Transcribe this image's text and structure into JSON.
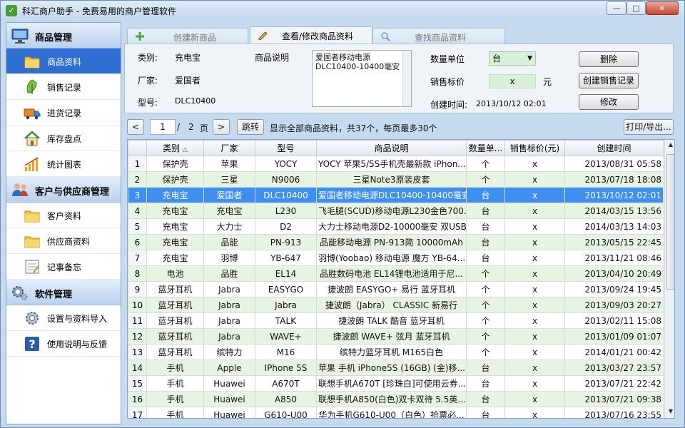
{
  "window": {
    "title": "科汇商户助手 - 免费易用的商户管理软件",
    "min": "—",
    "max": "□",
    "close": "✕"
  },
  "sidebar": {
    "groups": [
      {
        "label": "商品管理",
        "icon": "monitor-icon"
      },
      {
        "label": "客户与供应商管理",
        "icon": "people-icon"
      },
      {
        "label": "软件管理",
        "icon": "gears-icon"
      }
    ],
    "items": [
      {
        "label": "商品资料",
        "icon": "folder-icon",
        "active": true
      },
      {
        "label": "销售记录",
        "icon": "leaf-icon"
      },
      {
        "label": "进货记录",
        "icon": "truck-icon"
      },
      {
        "label": "库存盘点",
        "icon": "house-icon"
      },
      {
        "label": "统计图表",
        "icon": "chart-icon"
      },
      {
        "label": "客户资料",
        "icon": "folder-icon"
      },
      {
        "label": "供应商资料",
        "icon": "folder-icon"
      },
      {
        "label": "记事备忘",
        "icon": "notepad-icon"
      },
      {
        "label": "设置与资料导入",
        "icon": "gear-icon"
      },
      {
        "label": "使用说明与反馈",
        "icon": "help-icon"
      }
    ]
  },
  "tabs": [
    {
      "label": "创建新商品",
      "icon": "plus-icon"
    },
    {
      "label": "查看/修改商品资料",
      "icon": "pencil-icon",
      "active": true
    },
    {
      "label": "查找商品资料",
      "icon": "search-icon"
    }
  ],
  "form": {
    "category_label": "类别:",
    "category_value": "充电宝",
    "maker_label": "厂家:",
    "maker_value": "爱国者",
    "model_label": "型号:",
    "model_value": "DLC10400",
    "desc_label": "商品说明",
    "desc_line1": "爱国者移动电源",
    "desc_line2": "DLC10400-10400毫安",
    "unit_label": "数量单位",
    "unit_value": "台",
    "price_label": "销售标价",
    "price_value": "x",
    "price_unit": "元",
    "created_label": "创建时间:",
    "created_value": "2013/10/12 02:01",
    "delete_btn": "删除",
    "create_sale_btn": "创建销售记录",
    "modify_btn": "修改"
  },
  "pager": {
    "prev": "<",
    "page": "1",
    "sep": "/",
    "total": "2",
    "page_word": "页",
    "next": ">",
    "jump": "跳转",
    "info": "显示全部商品资料，共37个，每页最多30个",
    "print_export": "打印/导出..."
  },
  "table": {
    "headers": [
      "",
      "类别",
      "厂家",
      "型号",
      "商品说明",
      "数量单...",
      "销售标价(元)",
      "创建时间"
    ],
    "sort_indicator": "△",
    "rows": [
      [
        "1",
        "保护壳",
        "苹果",
        "YOCY",
        "YOCY 苹果5/5S手机壳最新款 iPhon...",
        "个",
        "x",
        "2013/08/31 05:58"
      ],
      [
        "2",
        "保护壳",
        "三星",
        "N9006",
        "三星Note3原装皮套",
        "个",
        "x",
        "2013/07/18 18:08"
      ],
      [
        "3",
        "充电宝",
        "爱国者",
        "DLC10400",
        "爱国者移动电源DLC10400-10400毫安",
        "台",
        "x",
        "2013/10/12 02:01"
      ],
      [
        "4",
        "充电宝",
        "充电宝",
        "L230",
        "飞毛腿(SCUD)移动电源L230金色700...",
        "台",
        "x",
        "2014/03/15 13:56"
      ],
      [
        "5",
        "充电宝",
        "大力士",
        "D2",
        "大力士移动电源D2-10000毫安 双USB",
        "台",
        "x",
        "2014/03/13 14:03"
      ],
      [
        "6",
        "充电宝",
        "品能",
        "PN-913",
        "品能移动电源 PN-913简 10000mAh",
        "台",
        "x",
        "2013/05/15 22:45"
      ],
      [
        "7",
        "充电宝",
        "羽博",
        "YB-647",
        "羽博(Yoobao) 移动电源 魔方 YB-64...",
        "台",
        "x",
        "2013/11/21 08:46"
      ],
      [
        "8",
        "电池",
        "品胜",
        "EL14",
        "品胜数码电池 EL14锂电池适用于尼...",
        "个",
        "x",
        "2013/04/10 20:49"
      ],
      [
        "9",
        "蓝牙耳机",
        "Jabra",
        "EASYGO",
        "捷波朗 EASYGO+ 易行 蓝牙耳机",
        "个",
        "x",
        "2013/09/24 19:45"
      ],
      [
        "10",
        "蓝牙耳机",
        "Jabra",
        "Jabra",
        "捷波朗（Jabra） CLASSIC 新易行",
        "个",
        "x",
        "2013/09/03 20:27"
      ],
      [
        "11",
        "蓝牙耳机",
        "Jabra",
        "TALK",
        "捷波朗 TALK 酷音 蓝牙耳机",
        "个",
        "x",
        "2013/02/11 15:08"
      ],
      [
        "12",
        "蓝牙耳机",
        "Jabra",
        "WAVE+",
        "捷波朗 WAVE+ 弦月 蓝牙耳机",
        "个",
        "x",
        "2013/01/09 01:07"
      ],
      [
        "13",
        "蓝牙耳机",
        "缤特力",
        "M16",
        "缤特力蓝牙耳机 M165白色",
        "个",
        "x",
        "2014/01/21 00:42"
      ],
      [
        "14",
        "手机",
        "Apple",
        "IPhone 5S",
        "苹果 手机 iPhone5S (16GB) (金)移...",
        "台",
        "x",
        "2013/03/27 23:57"
      ],
      [
        "15",
        "手机",
        "Huawei",
        "A670T",
        "联想手机A670T [珍珠白]可使用云券...",
        "台",
        "x",
        "2013/07/21 22:42"
      ],
      [
        "16",
        "手机",
        "Huawei",
        "A850",
        "联想手机A850(白色)双卡双待 5.5英...",
        "台",
        "x",
        "2013/07/21 09:38"
      ],
      [
        "17",
        "手机",
        "Huawei",
        "G610-U00",
        "华为手机G610-U00（白色）抢票必...",
        "台",
        "x",
        "2013/07/16 23:55"
      ]
    ]
  },
  "colors": {
    "selected_row": "#3f8ff0",
    "alt_row": "#e8f4e2",
    "sidebar_active": "#2f6fd1"
  }
}
